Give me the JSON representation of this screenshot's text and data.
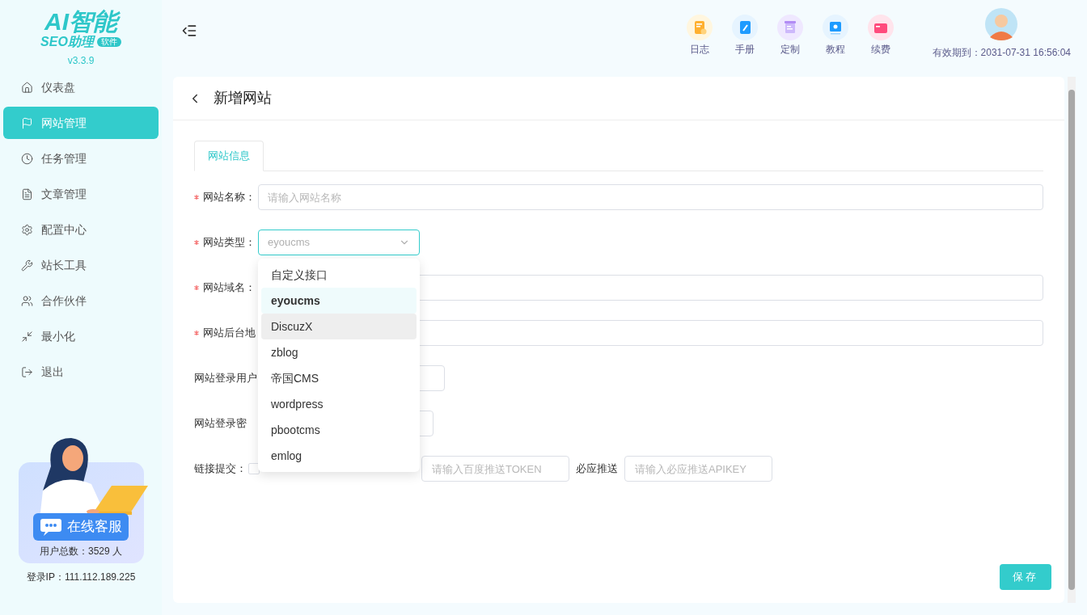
{
  "logo": {
    "title": "AI智能",
    "subtitle": "SEO助理",
    "badge": "软件",
    "version": "v3.3.9"
  },
  "sidebar": {
    "items": [
      {
        "label": "仪表盘",
        "selected": false
      },
      {
        "label": "网站管理",
        "selected": true
      },
      {
        "label": "任务管理",
        "selected": false
      },
      {
        "label": "文章管理",
        "selected": false
      },
      {
        "label": "配置中心",
        "selected": false
      },
      {
        "label": "站长工具",
        "selected": false
      },
      {
        "label": "合作伙伴",
        "selected": false
      },
      {
        "label": "最小化",
        "selected": false
      },
      {
        "label": "退出",
        "selected": false
      }
    ],
    "support": {
      "button": "在线客服",
      "users": "用户总数：3529 人"
    },
    "login_ip": "登录IP：111.112.189.225"
  },
  "header": {
    "tools": [
      {
        "label": "日志",
        "color": "#ffb030"
      },
      {
        "label": "手册",
        "color": "#1e9bff"
      },
      {
        "label": "定制",
        "color": "#b28cf5"
      },
      {
        "label": "教程",
        "color": "#1e9bff"
      },
      {
        "label": "续费",
        "color": "#ff4b7d"
      }
    ],
    "expiry": "有效期到：2031-07-31 16:56:04"
  },
  "page": {
    "title": "新增网站",
    "tabs": [
      {
        "label": "网站信息",
        "selected": true
      }
    ],
    "fields": [
      {
        "label": "网站名称：",
        "required": true,
        "kind": "input",
        "placeholder": "请输入网站名称"
      },
      {
        "label": "网站类型：",
        "required": true,
        "kind": "select",
        "value": "eyoucms"
      },
      {
        "label": "网站域名：",
        "required": true,
        "kind": "input"
      },
      {
        "label": "网站后台地",
        "required": true,
        "kind": "input"
      },
      {
        "label": "网站登录用户",
        "required": false,
        "kind": "input"
      },
      {
        "label": "网站登录密",
        "required": false,
        "kind": "input"
      }
    ],
    "link_submit": {
      "label": "链接提交：",
      "checked": false,
      "baidu_placeholder": "请输入百度推送TOKEN",
      "bing_label": "必应推送",
      "bing_placeholder": "请输入必应推送APIKEY"
    },
    "dropdown": {
      "options": [
        {
          "label": "自定义接口",
          "selected": false,
          "hovered": false
        },
        {
          "label": "eyoucms",
          "selected": true,
          "hovered": false
        },
        {
          "label": "DiscuzX",
          "selected": false,
          "hovered": true
        },
        {
          "label": "zblog",
          "selected": false,
          "hovered": false
        },
        {
          "label": "帝国CMS",
          "selected": false,
          "hovered": false
        },
        {
          "label": "wordpress",
          "selected": false,
          "hovered": false
        },
        {
          "label": "pbootcms",
          "selected": false,
          "hovered": false
        },
        {
          "label": "emlog",
          "selected": false,
          "hovered": false
        }
      ]
    },
    "save_button": "保存"
  }
}
